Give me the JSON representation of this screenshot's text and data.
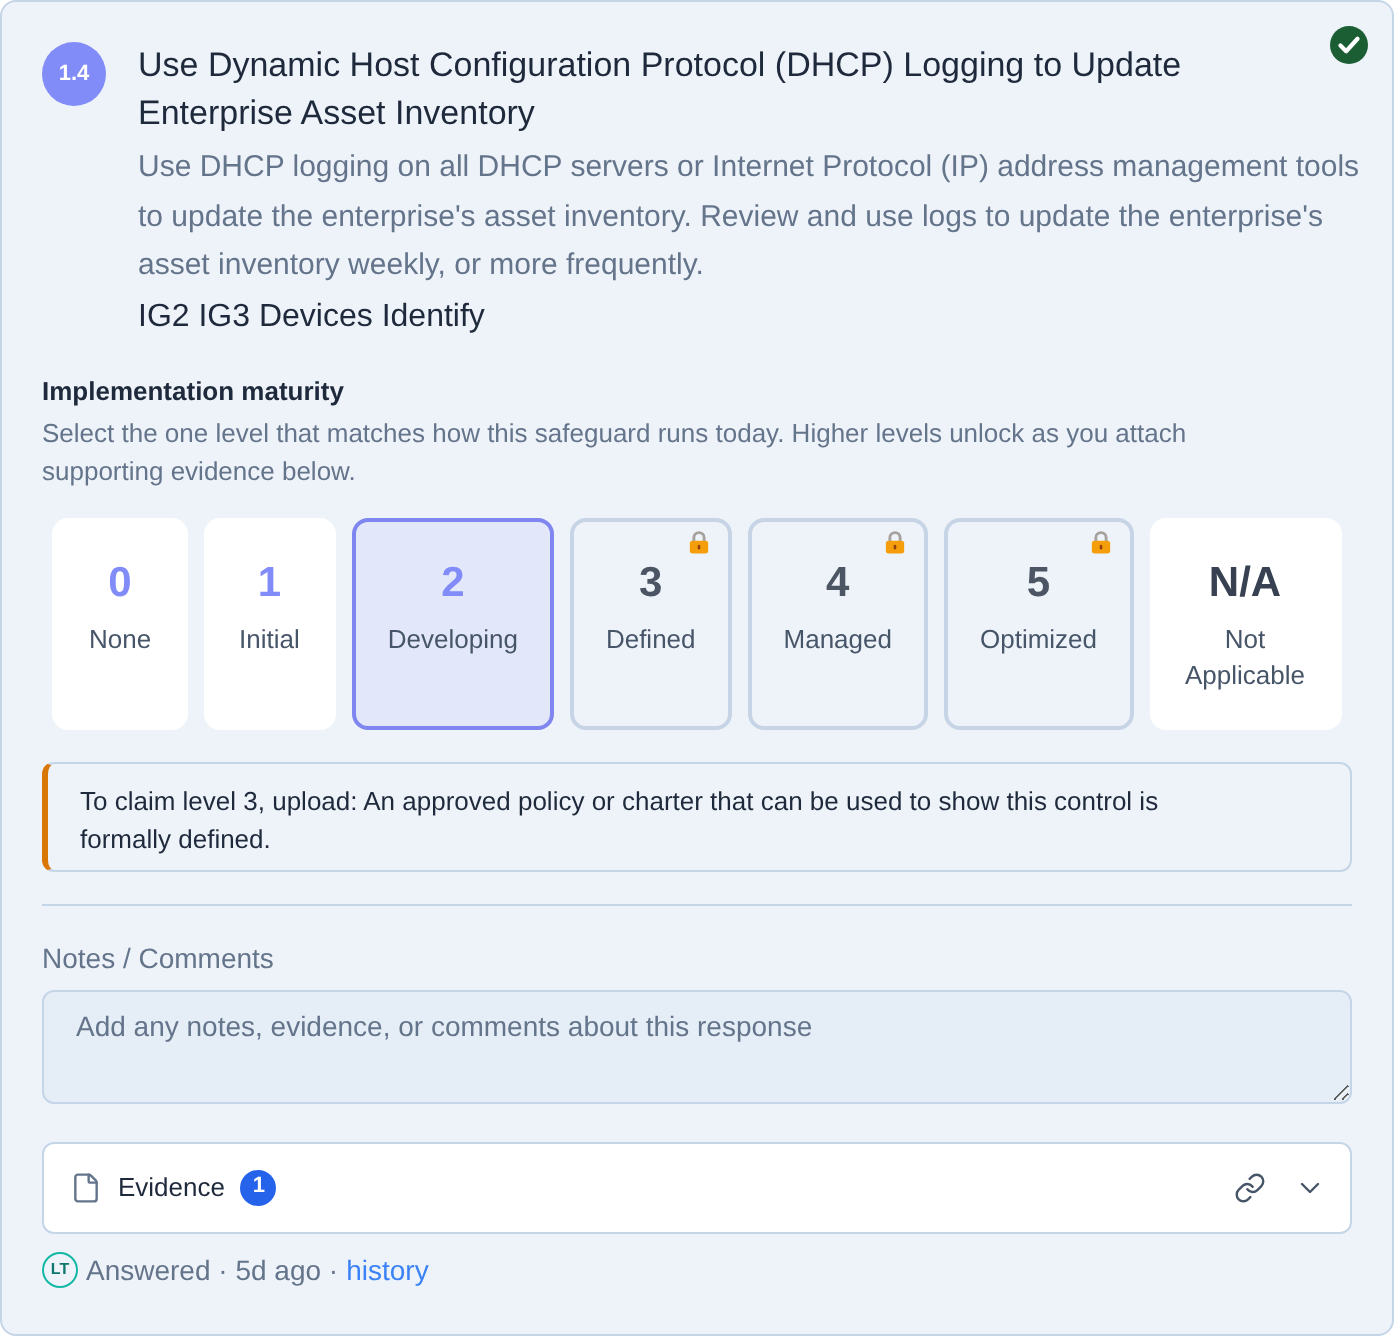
{
  "safeguard": {
    "number": "1.4",
    "title": "Use Dynamic Host Configuration Protocol (DHCP) Logging to Update Enterprise Asset Inventory",
    "completed": true,
    "description": "Use DHCP logging on all DHCP servers or Internet Protocol (IP) address management tools to update the enterprise's asset inventory. Review and use logs to update the enterprise's asset inventory weekly, or more frequently.",
    "tags": "IG2 IG3 Devices Identify"
  },
  "maturity": {
    "heading": "Implementation maturity",
    "help": "Select the one level that matches how this safeguard runs today. Higher levels unlock as you attach supporting evidence below.",
    "levels": [
      {
        "kind": "level",
        "value": "0",
        "label": "None",
        "selected": false,
        "locked": false
      },
      {
        "kind": "level",
        "value": "1",
        "label": "Initial",
        "selected": false,
        "locked": false
      },
      {
        "kind": "level",
        "value": "2",
        "label": "Developing",
        "selected": true,
        "locked": false
      },
      {
        "kind": "level",
        "value": "3",
        "label": "Defined",
        "selected": false,
        "locked": true
      },
      {
        "kind": "level",
        "value": "4",
        "label": "Managed",
        "selected": false,
        "locked": true
      },
      {
        "kind": "level",
        "value": "5",
        "label": "Optimized",
        "selected": false,
        "locked": true
      },
      {
        "kind": "not_applicable",
        "value": "N/A",
        "label": "Not Applicable",
        "selected": false,
        "locked": false
      }
    ],
    "requirement": "To claim level 3, upload: An approved policy or charter that can be used to show this control is formally defined."
  },
  "notes": {
    "label": "Notes / Comments",
    "placeholder": "Add any notes, evidence, or comments about this response"
  },
  "evidence": {
    "label": "Evidence",
    "count": "1",
    "expanded": false
  },
  "footer": {
    "avatar": "LT",
    "status": "Answered · 5d ago ·",
    "link": "history"
  }
}
